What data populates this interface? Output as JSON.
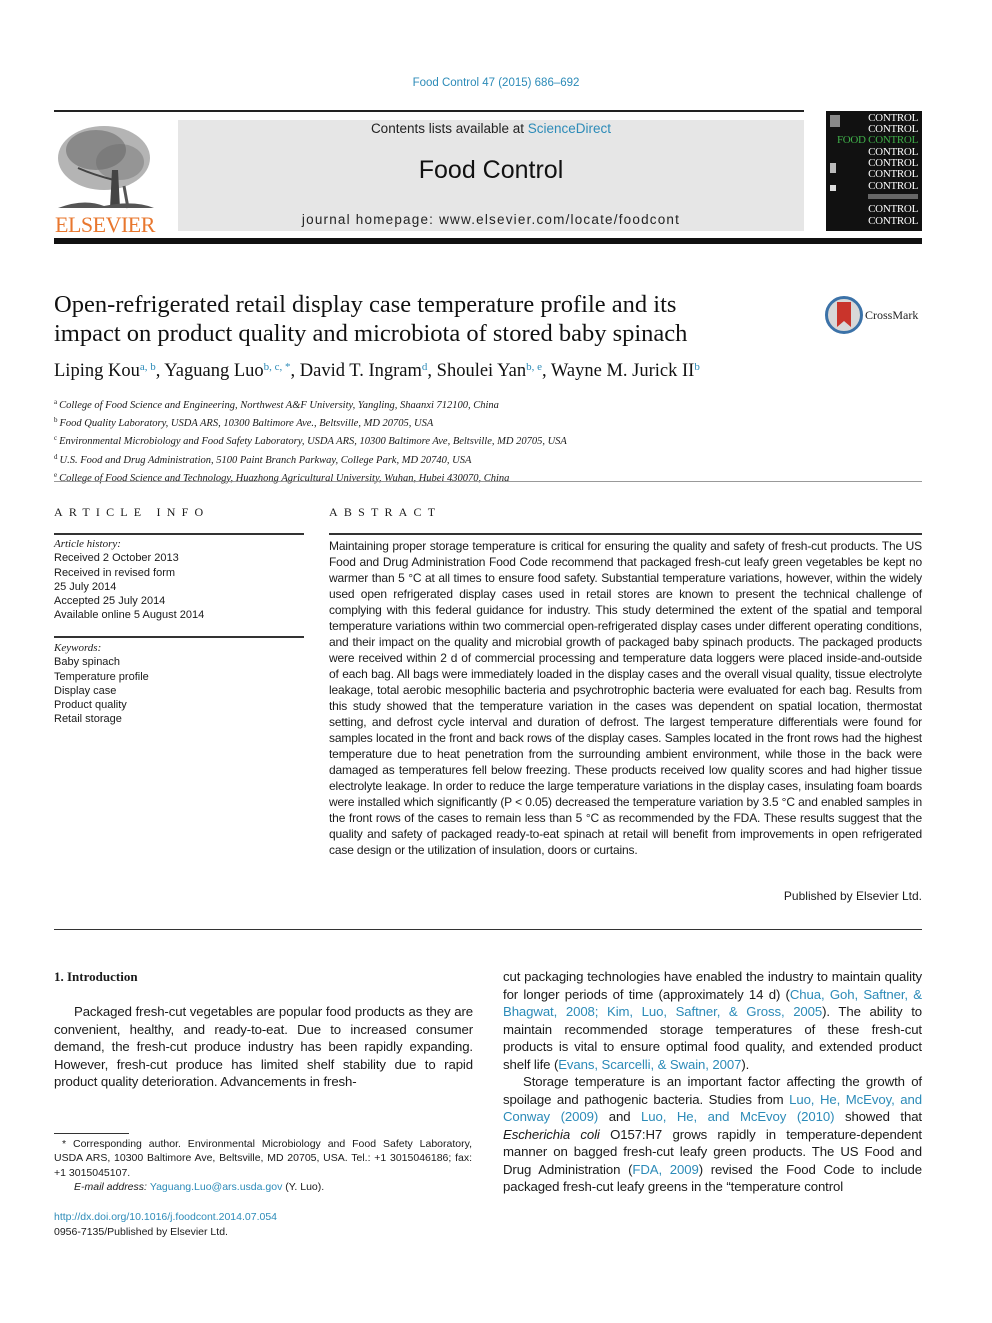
{
  "header": {
    "citation": "Food Control 47 (2015) 686–692",
    "publisher_logo_text": "ELSEVIER",
    "contents_prefix": "Contents lists available at ",
    "contents_link": "ScienceDirect",
    "journal_title": "Food Control",
    "homepage_label": "journal homepage: ",
    "homepage_url": "www.elsevier.com/locate/foodcont",
    "cover_words": [
      "CONTROL",
      "CONTROL",
      "FOOD CONTROL",
      "CONTROL",
      "CONTROL",
      "CONTROL",
      "CONTROL",
      "CONTROL",
      "CONTROL"
    ],
    "colors": {
      "link": "#2c8bb8",
      "elsevier_orange": "#e8772e",
      "cover_green": "#3fae49"
    }
  },
  "article": {
    "title_line1": "Open-refrigerated retail display case temperature profile and its",
    "title_line2": "impact on product quality and microbiota of stored baby spinach",
    "crossmark_label": "CrossMark",
    "authors": [
      {
        "name": "Liping Kou",
        "sup": "a, b",
        "sep": ", "
      },
      {
        "name": "Yaguang Luo",
        "sup": "b, c, *",
        "sep": ", "
      },
      {
        "name": "David T. Ingram",
        "sup": "d",
        "sep": ", "
      },
      {
        "name": "Shoulei Yan",
        "sup": "b, e",
        "sep": ", "
      },
      {
        "name": "Wayne M. Jurick II",
        "sup": "b",
        "sep": ""
      }
    ],
    "affiliations": [
      {
        "key": "a",
        "text": "College of Food Science and Engineering, Northwest A&F University, Yangling, Shaanxi 712100, China"
      },
      {
        "key": "b",
        "text": "Food Quality Laboratory, USDA ARS, 10300 Baltimore Ave., Beltsville, MD 20705, USA"
      },
      {
        "key": "c",
        "text": "Environmental Microbiology and Food Safety Laboratory, USDA ARS, 10300 Baltimore Ave, Beltsville, MD 20705, USA"
      },
      {
        "key": "d",
        "text": "U.S. Food and Drug Administration, 5100 Paint Branch Parkway, College Park, MD 20740, USA"
      },
      {
        "key": "e",
        "text": "College of Food Science and Technology, Huazhong Agricultural University, Wuhan, Hubei 430070, China"
      }
    ]
  },
  "article_info": {
    "heading": "ARTICLE INFO",
    "history_label": "Article history:",
    "history": [
      "Received 2 October 2013",
      "Received in revised form",
      "25 July 2014",
      "Accepted 25 July 2014",
      "Available online 5 August 2014"
    ],
    "keywords_label": "Keywords:",
    "keywords": [
      "Baby spinach",
      "Temperature profile",
      "Display case",
      "Product quality",
      "Retail storage"
    ]
  },
  "abstract": {
    "heading": "ABSTRACT",
    "text": "Maintaining proper storage temperature is critical for ensuring the quality and safety of fresh-cut products. The US Food and Drug Administration Food Code recommend that packaged fresh-cut leafy green vegetables be kept no warmer than 5 °C at all times to ensure food safety. Substantial temperature variations, however, within the widely used open refrigerated display cases used in retail stores are known to present the technical challenge of complying with this federal guidance for industry. This study determined the extent of the spatial and temporal temperature variations within two commercial open-refrigerated display cases under different operating conditions, and their impact on the quality and microbial growth of packaged baby spinach products. The packaged products were received within 2 d of commercial processing and temperature data loggers were placed inside-and-outside of each bag. All bags were immediately loaded in the display cases and the overall visual quality, tissue electrolyte leakage, total aerobic mesophilic bacteria and psychrotrophic bacteria were evaluated for each bag. Results from this study showed that the temperature variation in the cases was dependent on spatial location, thermostat setting, and defrost cycle interval and duration of defrost. The largest temperature differentials were found for samples located in the front and back rows of the display cases. Samples located in the front rows had the highest temperature due to heat penetration from the surrounding ambient environment, while those in the back were damaged as temperatures fell below freezing. These products received low quality scores and had higher tissue electrolyte leakage. In order to reduce the large temperature variations in the display cases, insulating foam boards were installed which significantly (P < 0.05) decreased the temperature variation by 3.5 °C and enabled samples in the front rows of the cases to remain less than 5 °C as recommended by the FDA. These results suggest that the quality and safety of packaged ready-to-eat spinach at retail will benefit from improvements in open refrigerated case design or the utilization of insulation, doors or curtains.",
    "published_by": "Published by Elsevier Ltd."
  },
  "introduction": {
    "heading": "1.  Introduction",
    "left_p1": "Packaged fresh-cut vegetables are popular food products as they are convenient, healthy, and ready-to-eat. Due to increased consumer demand, the fresh-cut produce industry has been rapidly expanding. However, fresh-cut produce has limited shelf stability due to rapid product quality deterioration. Advancements in fresh-",
    "right_p1_a": "cut packaging technologies have enabled the industry to maintain quality for longer periods of time (approximately 14 d) (",
    "right_p1_ref1": "Chua, Goh, Saftner, & Bhagwat, 2008; Kim, Luo, Saftner, & Gross, 2005",
    "right_p1_b": "). The ability to maintain recommended storage temperatures of these fresh-cut products is vital to ensure optimal food quality, and extended product shelf life (",
    "right_p1_ref2": "Evans, Scarcelli, & Swain, 2007",
    "right_p1_c": ").",
    "right_p2_a": "Storage temperature is an important factor affecting the growth of spoilage and pathogenic bacteria. Studies from ",
    "right_p2_ref1": "Luo, He, McEvoy, and Conway (2009)",
    "right_p2_b": " and ",
    "right_p2_ref2": "Luo, He, and McEvoy (2010)",
    "right_p2_c": " showed that ",
    "right_p2_species": "Escherichia coli",
    "right_p2_d": " O157:H7 grows rapidly in temperature-dependent manner on bagged fresh-cut leafy green products. The US Food and Drug Administration (",
    "right_p2_ref3": "FDA, 2009",
    "right_p2_e": ") revised the Food Code to include packaged fresh-cut leafy greens in the “temperature control"
  },
  "footnotes": {
    "corresponding": "* Corresponding author. Environmental Microbiology and Food Safety Laboratory, USDA ARS, 10300 Baltimore Ave, Beltsville, MD 20705, USA. Tel.: +1 3015046186; fax: +1 3015045107.",
    "email_label": "E-mail address: ",
    "email": "Yaguang.Luo@ars.usda.gov",
    "email_suffix": " (Y. Luo).",
    "doi": "http://dx.doi.org/10.1016/j.foodcont.2014.07.054",
    "issn": "0956-7135/Published by Elsevier Ltd."
  }
}
